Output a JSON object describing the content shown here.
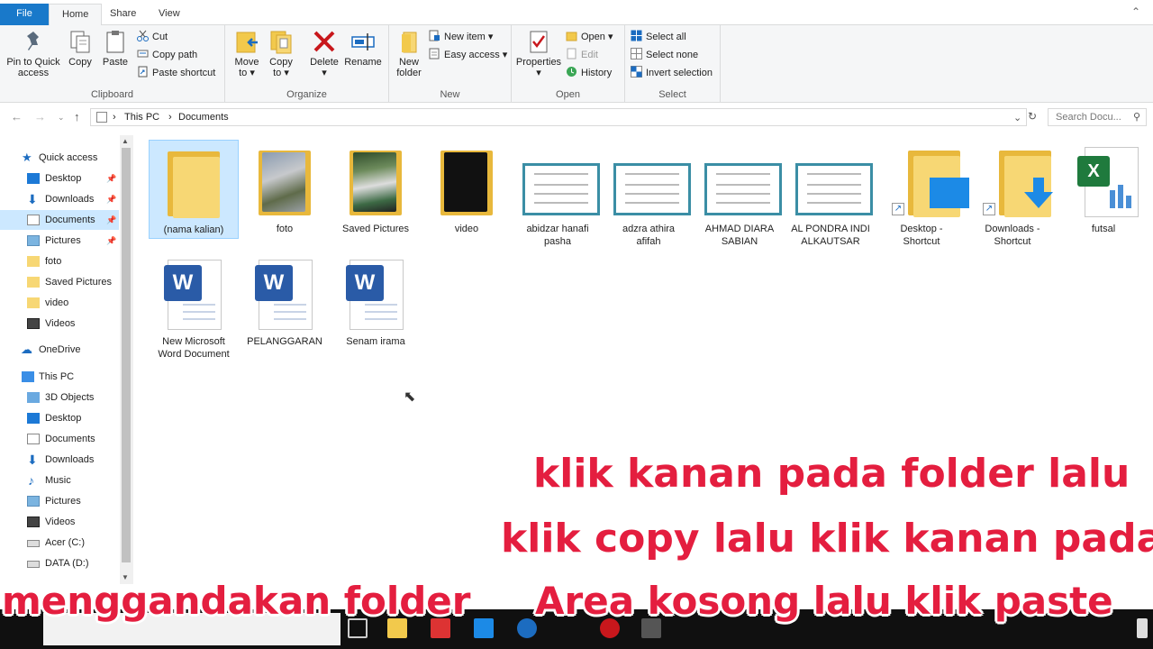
{
  "tabs": {
    "file": "File",
    "home": "Home",
    "share": "Share",
    "view": "View"
  },
  "ribbon": {
    "clipboard": {
      "label": "Clipboard",
      "pin_line1": "Pin to Quick",
      "pin_line2": "access",
      "copy": "Copy",
      "paste": "Paste",
      "cut": "Cut",
      "copy_path": "Copy path",
      "paste_shortcut": "Paste shortcut"
    },
    "organize": {
      "label": "Organize",
      "move_line1": "Move",
      "move_line2": "to",
      "copy_line1": "Copy",
      "copy_line2": "to",
      "delete": "Delete",
      "rename": "Rename"
    },
    "new": {
      "label": "New",
      "folder_line1": "New",
      "folder_line2": "folder",
      "new_item": "New item",
      "easy_access": "Easy access"
    },
    "open": {
      "label": "Open",
      "properties": "Properties",
      "open": "Open",
      "edit": "Edit",
      "history": "History"
    },
    "select": {
      "label": "Select",
      "select_all": "Select all",
      "select_none": "Select none",
      "invert": "Invert selection"
    }
  },
  "address": {
    "crumbs": [
      "This PC",
      "Documents"
    ],
    "search_placeholder": "Search Docu..."
  },
  "navpane": {
    "quick_access": "Quick access",
    "qa_items": [
      "Desktop",
      "Downloads",
      "Documents",
      "Pictures",
      "foto",
      "Saved Pictures",
      "video",
      "Videos"
    ],
    "onedrive": "OneDrive",
    "this_pc": "This PC",
    "pc_items": [
      "3D Objects",
      "Desktop",
      "Documents",
      "Downloads",
      "Music",
      "Pictures",
      "Videos",
      "Acer (C:)",
      "DATA (D:)"
    ]
  },
  "files": {
    "f1": "(nama kalian)",
    "f2": "foto",
    "f3": "Saved Pictures",
    "f4": "video",
    "f5a": "abidzar hanafi",
    "f5b": "pasha",
    "f6a": "adzra athira",
    "f6b": "afifah",
    "f7a": "AHMAD DIARA",
    "f7b": "SABIAN",
    "f8a": "AL PONDRA INDI",
    "f8b": "ALKAUTSAR",
    "f9a": "Desktop -",
    "f9b": "Shortcut",
    "f10a": "Downloads -",
    "f10b": "Shortcut",
    "f11": "futsal",
    "f12a": "New Microsoft",
    "f12b": "Word Document",
    "f13": "PELANGGARAN",
    "f14": "Senam irama"
  },
  "captions": {
    "line1": "klik kanan pada folder lalu",
    "line2": "klik copy lalu klik kanan pada",
    "line3a": "menggandakan folder",
    "line3b": "Area kosong lalu klik paste"
  },
  "colors": {
    "accent": "#1979ca",
    "caption": "#e41e3f",
    "folder": "#f7d774",
    "selection": "#cce8ff"
  }
}
